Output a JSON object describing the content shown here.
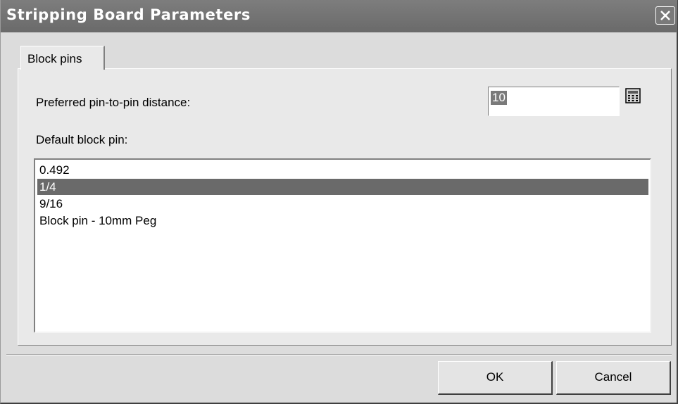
{
  "window": {
    "title": "Stripping Board Parameters",
    "close_icon": "close-x-icon"
  },
  "tabs": [
    {
      "label": "Block pins",
      "active": true
    }
  ],
  "form": {
    "distance_label": "Preferred pin-to-pin distance:",
    "distance_value": "10",
    "calculator_icon": "calculator-icon",
    "default_pin_label": "Default block pin:",
    "pins": [
      {
        "label": "0.492",
        "selected": false
      },
      {
        "label": "1/4",
        "selected": true
      },
      {
        "label": "9/16",
        "selected": false
      },
      {
        "label": "Block pin - 10mm Peg",
        "selected": false
      }
    ]
  },
  "buttons": {
    "ok": "OK",
    "cancel": "Cancel"
  },
  "colors": {
    "titlebar": "#6e6e6e",
    "selection": "#6a6a6a",
    "dialog_bg": "#dcdcdc"
  }
}
